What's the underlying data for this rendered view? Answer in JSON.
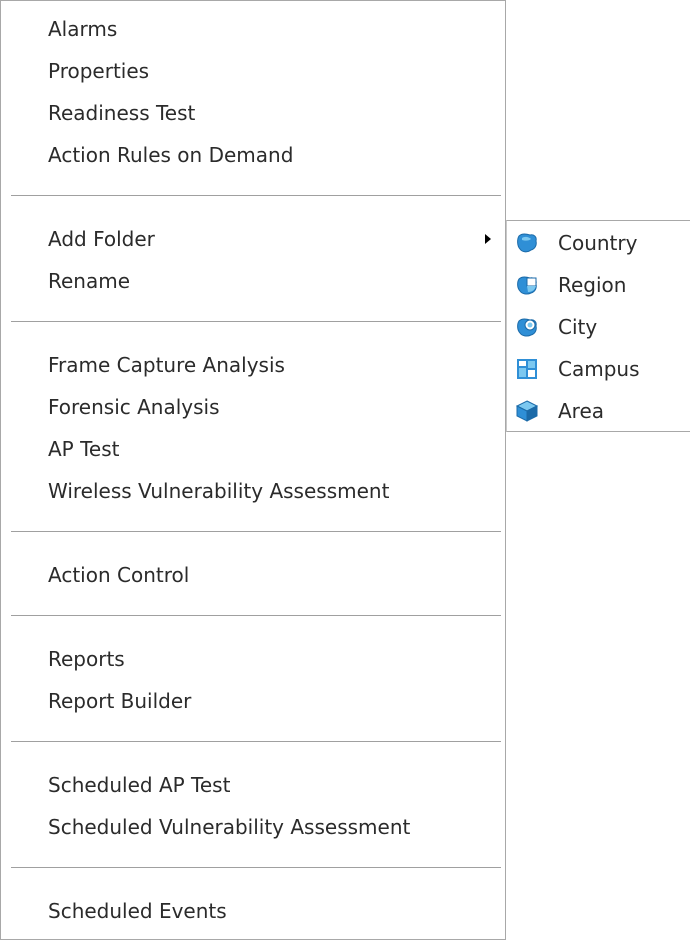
{
  "menu": {
    "items": [
      {
        "label": "Alarms"
      },
      {
        "label": "Properties"
      },
      {
        "label": "Readiness Test"
      },
      {
        "label": "Action Rules on Demand"
      },
      {
        "label": "Add Folder"
      },
      {
        "label": "Rename"
      },
      {
        "label": "Frame Capture Analysis"
      },
      {
        "label": "Forensic Analysis"
      },
      {
        "label": "AP Test"
      },
      {
        "label": "Wireless Vulnerability Assessment"
      },
      {
        "label": "Action Control"
      },
      {
        "label": "Reports"
      },
      {
        "label": "Report Builder"
      },
      {
        "label": "Scheduled AP Test"
      },
      {
        "label": "Scheduled Vulnerability Assessment"
      },
      {
        "label": "Scheduled Events"
      }
    ]
  },
  "submenu": {
    "items": [
      {
        "label": "Country",
        "icon": "country-icon"
      },
      {
        "label": "Region",
        "icon": "region-icon"
      },
      {
        "label": "City",
        "icon": "city-icon"
      },
      {
        "label": "Campus",
        "icon": "campus-icon"
      },
      {
        "label": "Area",
        "icon": "area-icon"
      }
    ]
  },
  "colors": {
    "text": "#2b2b2b",
    "separator": "#a0a0a0",
    "border": "#a8a8a8",
    "icon_blue": "#2f8fd6",
    "icon_light": "#7cc8f0"
  }
}
